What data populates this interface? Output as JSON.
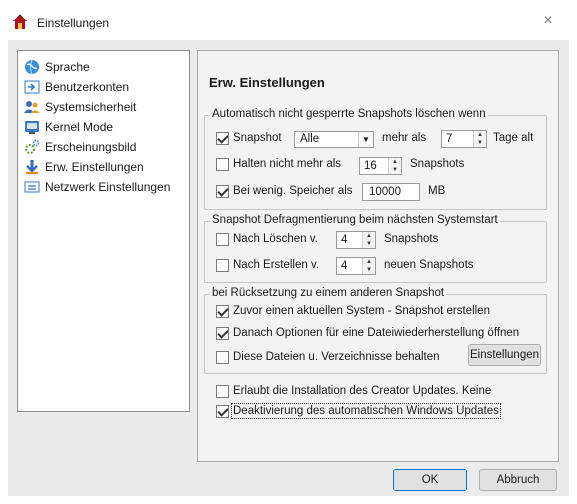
{
  "window": {
    "title": "Einstellungen",
    "close_glyph": "×"
  },
  "sidebar": {
    "items": [
      {
        "label": "Sprache",
        "icon": "globe-icon"
      },
      {
        "label": "Benutzerkonten",
        "icon": "user-accounts-icon"
      },
      {
        "label": "Systemsicherheit",
        "icon": "security-users-icon"
      },
      {
        "label": "Kernel Mode",
        "icon": "kernel-mode-icon"
      },
      {
        "label": "Erscheinungsbild",
        "icon": "appearance-gears-icon"
      },
      {
        "label": "Erw. Einstellungen",
        "icon": "advanced-settings-icon",
        "selected": true
      },
      {
        "label": "Netzwerk Einstellungen",
        "icon": "network-settings-icon"
      }
    ]
  },
  "panel": {
    "title": "Erw. Einstellungen",
    "group1": {
      "title": "Automatisch nicht gesperrte Snapshots löschen wenn",
      "snapshot_label": "Snapshot",
      "snapshot_checked": true,
      "snapshot_combo_value": "Alle",
      "mehr_als_label": "mehr als",
      "days_value": "7",
      "days_suffix": "Tage alt",
      "halten_label": "Halten nicht mehr als",
      "halten_checked": false,
      "halten_value": "16",
      "halten_suffix": "Snapshots",
      "speicher_label": "Bei wenig. Speicher als",
      "speicher_checked": true,
      "speicher_value": "10000",
      "speicher_unit": "MB"
    },
    "group2": {
      "title": "Snapshot Defragmentierung beim nächsten Systemstart",
      "loeschen_label": "Nach Löschen v.",
      "loeschen_checked": false,
      "loeschen_value": "4",
      "loeschen_suffix": "Snapshots",
      "erstellen_label": "Nach Erstellen v.",
      "erstellen_checked": false,
      "erstellen_value": "4",
      "erstellen_suffix": "neuen Snapshots"
    },
    "group3": {
      "title": "bei Rücksetzung zu einem anderen Snapshot",
      "opt1_label": "Zuvor einen aktuellen System - Snapshot erstellen",
      "opt1_checked": true,
      "opt2_label": "Danach Optionen für eine Dateiwiederherstellung öffnen",
      "opt2_checked": true,
      "opt3_label": "Diese Dateien u. Verzeichnisse behalten",
      "opt3_checked": false,
      "settings_button": "Einstellungen"
    },
    "creator_label": "Erlaubt die Installation des Creator Updates. Keine",
    "creator_checked": false,
    "windows_update_label": "Deaktivierung des automatischen Windows Updates",
    "windows_update_checked": true
  },
  "buttons": {
    "ok": "OK",
    "cancel": "Abbruch"
  },
  "colors": {
    "accent": "#0078d7",
    "panel_bg": "#f3f3f3",
    "client_bg": "#ececec"
  }
}
